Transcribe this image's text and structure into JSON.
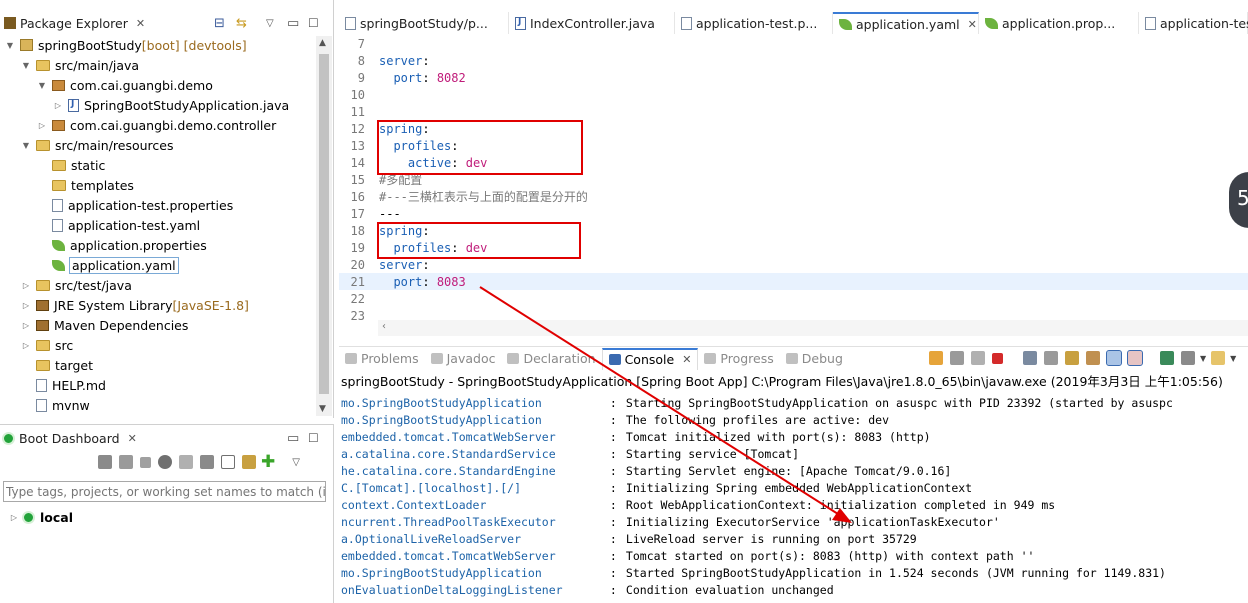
{
  "explorer": {
    "title": "Package Explorer",
    "tree": [
      {
        "indent": 0,
        "tw": "▼",
        "icon": "proj",
        "label": "springBootStudy",
        "deco": " [boot] [devtools]"
      },
      {
        "indent": 1,
        "tw": "▼",
        "icon": "folder",
        "label": "src/main/java"
      },
      {
        "indent": 2,
        "tw": "▼",
        "icon": "pkg",
        "label": "com.cai.guangbi.demo"
      },
      {
        "indent": 3,
        "tw": "▷",
        "icon": "java",
        "label": "SpringBootStudyApplication.java"
      },
      {
        "indent": 2,
        "tw": "▷",
        "icon": "pkg",
        "label": "com.cai.guangbi.demo.controller"
      },
      {
        "indent": 1,
        "tw": "▼",
        "icon": "folder",
        "label": "src/main/resources"
      },
      {
        "indent": 2,
        "tw": "",
        "icon": "folder",
        "label": "static"
      },
      {
        "indent": 2,
        "tw": "",
        "icon": "folder",
        "label": "templates"
      },
      {
        "indent": 2,
        "tw": "",
        "icon": "file",
        "label": "application-test.properties"
      },
      {
        "indent": 2,
        "tw": "",
        "icon": "file",
        "label": "application-test.yaml"
      },
      {
        "indent": 2,
        "tw": "",
        "icon": "leaf",
        "label": "application.properties"
      },
      {
        "indent": 2,
        "tw": "",
        "icon": "leaf",
        "label": "application.yaml",
        "selected": true
      },
      {
        "indent": 1,
        "tw": "▷",
        "icon": "folder",
        "label": "src/test/java"
      },
      {
        "indent": 1,
        "tw": "▷",
        "icon": "lib",
        "label": "JRE System Library",
        "deco": " [JavaSE-1.8]"
      },
      {
        "indent": 1,
        "tw": "▷",
        "icon": "lib",
        "label": "Maven Dependencies"
      },
      {
        "indent": 1,
        "tw": "▷",
        "icon": "folder",
        "label": "src"
      },
      {
        "indent": 1,
        "tw": "",
        "icon": "folder",
        "label": "target"
      },
      {
        "indent": 1,
        "tw": "",
        "icon": "file",
        "label": "HELP.md"
      },
      {
        "indent": 1,
        "tw": "",
        "icon": "file",
        "label": "mvnw"
      }
    ]
  },
  "dashboard": {
    "title": "Boot Dashboard",
    "filter_placeholder": "Type tags, projects, or working set names to match (in",
    "local_label": "local"
  },
  "editor_tabs": [
    {
      "label": "springBootStudy/p...",
      "icon": "file"
    },
    {
      "label": "IndexController.java",
      "icon": "java"
    },
    {
      "label": "application-test.p...",
      "icon": "file"
    },
    {
      "label": "application.yaml",
      "icon": "leaf",
      "active": true
    },
    {
      "label": "application.prop...",
      "icon": "leaf"
    },
    {
      "label": "application-test",
      "icon": "file"
    }
  ],
  "editor_lines": [
    {
      "n": "7",
      "parts": []
    },
    {
      "n": "8",
      "parts": [
        [
          "k",
          "server"
        ],
        [
          "p",
          ":"
        ]
      ]
    },
    {
      "n": "9",
      "parts": [
        [
          "p",
          "  "
        ],
        [
          "k",
          "port"
        ],
        [
          "p",
          ": "
        ],
        [
          "v",
          "8082"
        ]
      ]
    },
    {
      "n": "10",
      "parts": []
    },
    {
      "n": "11",
      "parts": []
    },
    {
      "n": "12",
      "parts": [
        [
          "k",
          "spring"
        ],
        [
          "p",
          ":"
        ]
      ]
    },
    {
      "n": "13",
      "parts": [
        [
          "p",
          "  "
        ],
        [
          "k",
          "profiles"
        ],
        [
          "p",
          ":"
        ]
      ]
    },
    {
      "n": "14",
      "parts": [
        [
          "p",
          "    "
        ],
        [
          "k",
          "active"
        ],
        [
          "p",
          ": "
        ],
        [
          "v",
          "dev"
        ]
      ]
    },
    {
      "n": "15",
      "parts": [
        [
          "c",
          "#多配置"
        ]
      ]
    },
    {
      "n": "16",
      "parts": [
        [
          "c",
          "#---三横杠表示与上面的配置是分开的"
        ]
      ]
    },
    {
      "n": "17",
      "parts": [
        [
          "p",
          "---"
        ]
      ]
    },
    {
      "n": "18",
      "parts": [
        [
          "k",
          "spring"
        ],
        [
          "p",
          ":"
        ]
      ]
    },
    {
      "n": "19",
      "parts": [
        [
          "p",
          "  "
        ],
        [
          "k",
          "profiles"
        ],
        [
          "p",
          ": "
        ],
        [
          "v",
          "dev"
        ]
      ]
    },
    {
      "n": "20",
      "parts": [
        [
          "k",
          "server"
        ],
        [
          "p",
          ":"
        ]
      ]
    },
    {
      "n": "21",
      "parts": [
        [
          "p",
          "  "
        ],
        [
          "k",
          "port"
        ],
        [
          "p",
          ": "
        ],
        [
          "v",
          "8083"
        ]
      ],
      "current": true
    },
    {
      "n": "22",
      "parts": []
    },
    {
      "n": "23",
      "parts": []
    }
  ],
  "bottom_tabs": [
    {
      "label": "Problems"
    },
    {
      "label": "Javadoc"
    },
    {
      "label": "Declaration"
    },
    {
      "label": "Console",
      "active": true
    },
    {
      "label": "Progress"
    },
    {
      "label": "Debug"
    }
  ],
  "console": {
    "header": "springBootStudy - SpringBootStudyApplication [Spring Boot App] C:\\Program Files\\Java\\jre1.8.0_65\\bin\\javaw.exe (2019年3月3日 上午1:05:56)",
    "lines": [
      {
        "logger": "mo.SpringBootStudyApplication",
        "msg": "Starting SpringBootStudyApplication on asuspc with PID 23392 (started by asuspc"
      },
      {
        "logger": "mo.SpringBootStudyApplication",
        "msg": "The following profiles are active: dev"
      },
      {
        "logger": "embedded.tomcat.TomcatWebServer",
        "msg": "Tomcat initialized with port(s): 8083 (http)"
      },
      {
        "logger": "a.catalina.core.StandardService",
        "msg": "Starting service [Tomcat]"
      },
      {
        "logger": "he.catalina.core.StandardEngine",
        "msg": "Starting Servlet engine: [Apache Tomcat/9.0.16]"
      },
      {
        "logger": "C.[Tomcat].[localhost].[/]",
        "msg": "Initializing Spring embedded WebApplicationContext"
      },
      {
        "logger": "context.ContextLoader",
        "msg": "Root WebApplicationContext: initialization completed in 949 ms"
      },
      {
        "logger": "ncurrent.ThreadPoolTaskExecutor",
        "msg": "Initializing ExecutorService 'applicationTaskExecutor'"
      },
      {
        "logger": "a.OptionalLiveReloadServer",
        "msg": "LiveReload server is running on port 35729"
      },
      {
        "logger": "embedded.tomcat.TomcatWebServer",
        "msg": "Tomcat started on port(s): 8083 (http) with context path ''"
      },
      {
        "logger": "mo.SpringBootStudyApplication",
        "msg": "Started SpringBootStudyApplication in 1.524 seconds (JVM running for 1149.831)"
      },
      {
        "logger": "onEvaluationDeltaLoggingListener",
        "msg": "Condition evaluation unchanged"
      }
    ]
  },
  "floating_badge": "5",
  "colors": {
    "annotation": "#e00000",
    "yaml_key": "#1a5fb4",
    "yaml_value": "#c01c7a",
    "logger": "#1d63a8"
  }
}
